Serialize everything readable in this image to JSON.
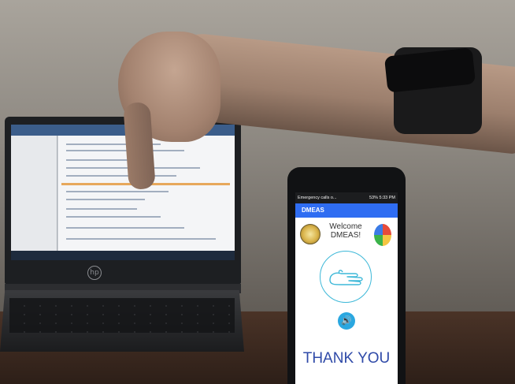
{
  "phone": {
    "status_left": "Emergency calls o...",
    "status_right": "53% 5:33 PM",
    "app_title": "DMEAS",
    "welcome_line1": "Welcome",
    "welcome_line2": "DMEAS!",
    "message": "THANK YOU",
    "speaker_icon": "speaker-icon",
    "gesture_icon": "hand-gesture-icon"
  },
  "laptop": {
    "logo": "hp"
  },
  "colors": {
    "app_bar": "#2f6df2",
    "message_text": "#2f4aa8",
    "gesture_outline": "#3db8d8",
    "speaker_button": "#2aa7e0"
  }
}
